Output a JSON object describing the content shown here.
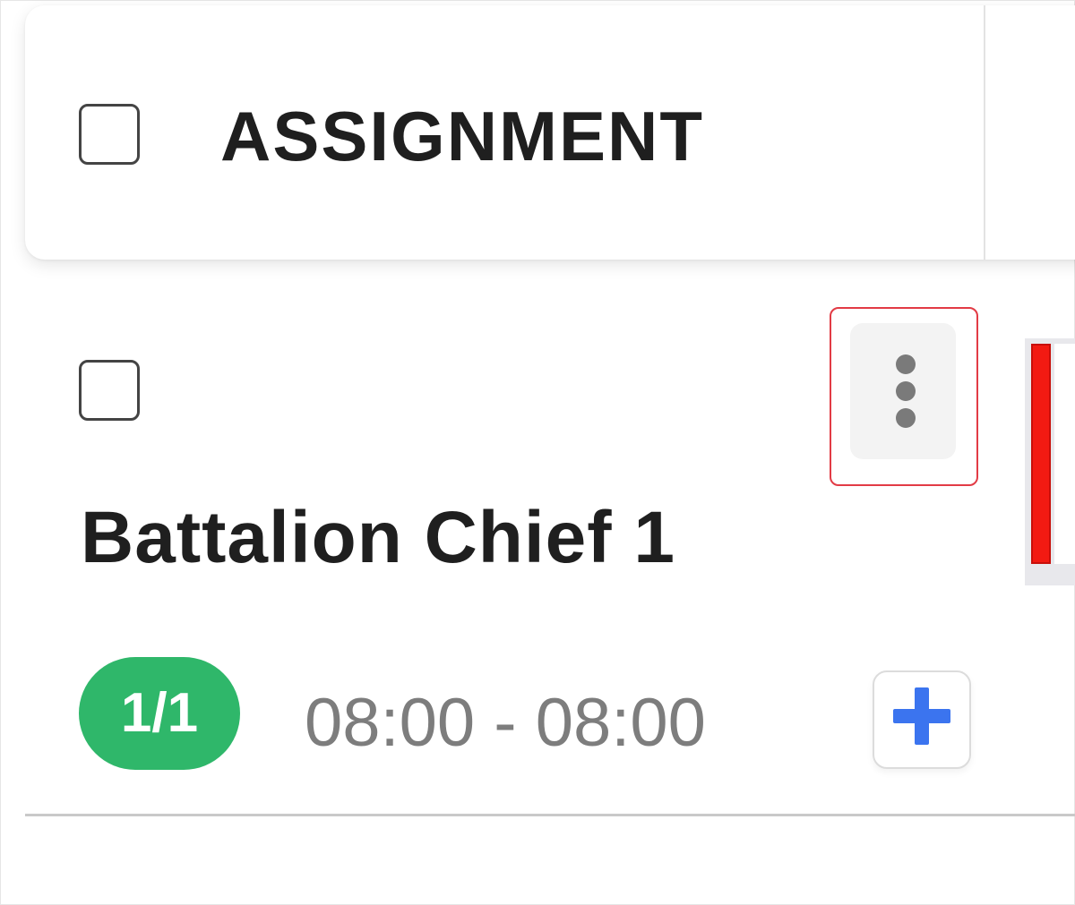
{
  "header": {
    "title": "ASSIGNMENT"
  },
  "row": {
    "name": "Battalion Chief 1",
    "count_badge": "1/1",
    "time_range": "08:00 - 08:00",
    "status_color": "#f21a12",
    "badge_color": "#2fb76a"
  },
  "icons": {
    "more": "more-vertical-icon",
    "add": "plus-icon"
  }
}
